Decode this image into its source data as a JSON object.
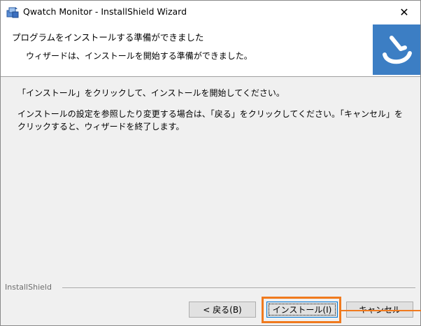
{
  "window": {
    "title": "Qwatch Monitor - InstallShield Wizard",
    "close_glyph": "✕"
  },
  "header": {
    "title": "プログラムをインストールする準備ができました",
    "subtitle": "ウィザードは、インストールを開始する準備ができました。"
  },
  "content": {
    "paragraph1": "「インストール」をクリックして、インストールを開始してください。",
    "paragraph2": "インストールの設定を参照したり変更する場合は、「戻る」をクリックしてください。「キャンセル」をクリックすると、ウィザードを終了します。"
  },
  "footer": {
    "brand": "InstallShield"
  },
  "buttons": {
    "back": "< 戻る(B)",
    "install": "インストール(I)",
    "cancel": "キャンセル"
  },
  "colors": {
    "logo_bg": "#3c7ec4",
    "highlight": "#f07a1e",
    "focus_border": "#0078d7"
  },
  "icons": {
    "app": "installer-box-icon",
    "logo": "installshield-swirl-icon",
    "close": "close-icon"
  }
}
